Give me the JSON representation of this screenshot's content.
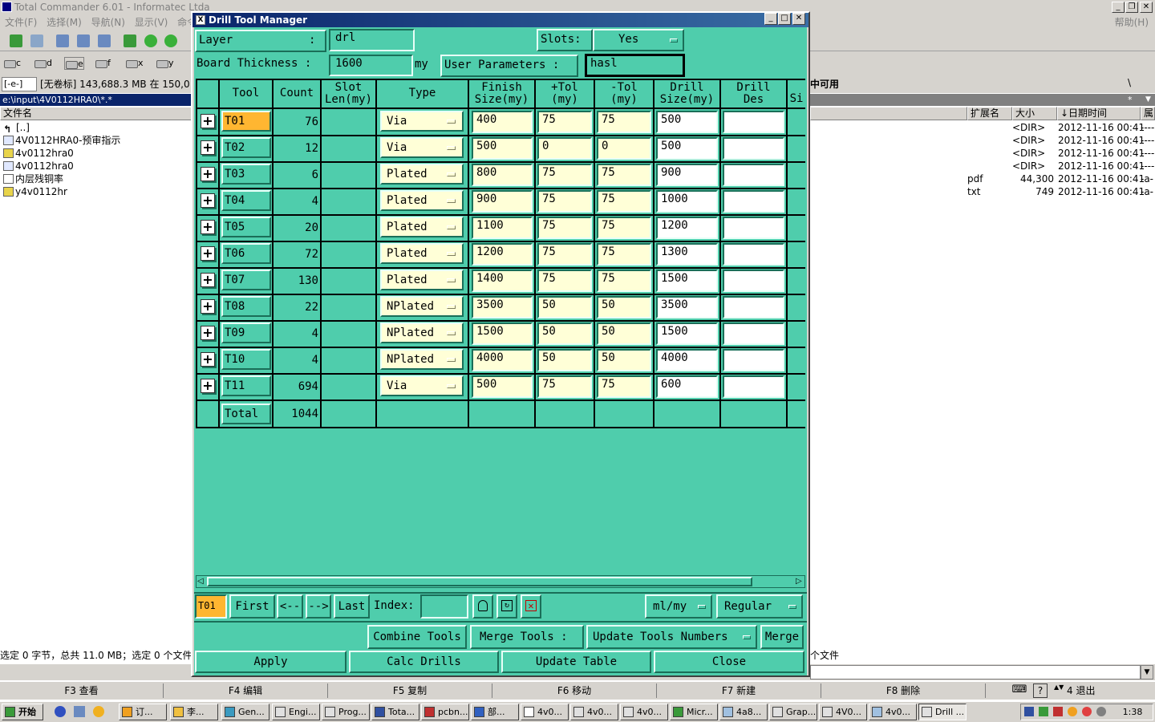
{
  "tc": {
    "title": "Total Commander 6.01 - Informatec Ltda",
    "menu": "文件(F)  选择(M)  导航(N)  显示(V)  命令(",
    "help": "帮助(H)",
    "drives": [
      "c",
      "d",
      "e",
      "f",
      "x",
      "y"
    ],
    "drive_select": "[-e-]",
    "drive_info": "[无卷标]  143,688.3 MB 在 150,0",
    "right_free": "中可用",
    "left_path": "e:\\input\\4V0112HRA0\\*.*",
    "left_header": "文件名",
    "right_headers": {
      "ext": "扩展名",
      "size": "大小",
      "date": "↓日期时间",
      "attr": "属"
    },
    "right_backslash": "\\",
    "right_star": "*",
    "left_files": [
      {
        "name": "[..]",
        "icon": "up-dir-icon"
      },
      {
        "name": "4V0112HRA0-预审指示",
        "icon": "doc-icon"
      },
      {
        "name": "4v0112hra0",
        "icon": "folder-icon"
      },
      {
        "name": "4v0112hra0",
        "icon": "doc-icon"
      },
      {
        "name": "内层残铜率",
        "icon": "text-icon"
      },
      {
        "name": "y4v0112hr",
        "icon": "folder-icon"
      }
    ],
    "right_files": [
      {
        "ext": "",
        "size": "<DIR>",
        "date": "2012-11-16 00:41",
        "attr": "----"
      },
      {
        "ext": "",
        "size": "<DIR>",
        "date": "2012-11-16 00:41",
        "attr": "----"
      },
      {
        "ext": "",
        "size": "<DIR>",
        "date": "2012-11-16 00:41",
        "attr": "----"
      },
      {
        "ext": "",
        "size": "<DIR>",
        "date": "2012-11-16 00:41",
        "attr": "----"
      },
      {
        "ext": "pdf",
        "size": "44,300",
        "date": "2012-11-16 00:41",
        "attr": "-a-"
      },
      {
        "ext": "txt",
        "size": "749",
        "date": "2012-11-16 00:41",
        "attr": "-a-"
      }
    ],
    "status_left": "选定 0 字节，总共 11.0 MB；选定 0 个文件",
    "status_right": "个文件",
    "fkeys": [
      "F3 查看",
      "F4 编辑",
      "F5 复制",
      "F6 移动",
      "F7 新建",
      "F8 删除"
    ],
    "exit": "4 退出",
    "help_q": "?"
  },
  "taskbar": {
    "start": "开始",
    "tasks": [
      "订...",
      "李...",
      "Gen...",
      "Engi...",
      "Prog...",
      "Tota...",
      "pcbn...",
      "部...",
      "4v0...",
      "4v0...",
      "4v0...",
      "Micr...",
      "4a8...",
      "Grap...",
      "4V0...",
      "4v0...",
      "Drill ..."
    ],
    "clock": "1:38"
  },
  "dialog": {
    "title": "Drill Tool Manager",
    "layer_label": "Layer",
    "colon": ":",
    "layer_value": "drl",
    "slots_label": "Slots:",
    "slots_value": "Yes",
    "board_label": "Board Thickness  :",
    "board_value": "1600",
    "board_unit": "my",
    "user_label": "User Parameters  :",
    "user_value": "hasl",
    "headers": {
      "tool": "Tool",
      "count": "Count",
      "slot1": "Slot",
      "slot2": "Len(my)",
      "type": "Type",
      "finish1": "Finish",
      "finish2": "Size(my)",
      "ptol1": "+Tol",
      "ptol2": "(my)",
      "mtol1": "-Tol",
      "mtol2": "(my)",
      "drill1": "Drill",
      "drill2": "Size(my)",
      "des1": "Drill",
      "des2": "Des",
      "si": "Si"
    },
    "rows": [
      {
        "tool": "T01",
        "count": "76",
        "type": "Via",
        "finish": "400",
        "ptol": "75",
        "mtol": "75",
        "drill": "500",
        "des": ""
      },
      {
        "tool": "T02",
        "count": "12",
        "type": "Via",
        "finish": "500",
        "ptol": "0",
        "mtol": "0",
        "drill": "500",
        "des": ""
      },
      {
        "tool": "T03",
        "count": "6",
        "type": "Plated",
        "finish": "800",
        "ptol": "75",
        "mtol": "75",
        "drill": "900",
        "des": ""
      },
      {
        "tool": "T04",
        "count": "4",
        "type": "Plated",
        "finish": "900",
        "ptol": "75",
        "mtol": "75",
        "drill": "1000",
        "des": ""
      },
      {
        "tool": "T05",
        "count": "20",
        "type": "Plated",
        "finish": "1100",
        "ptol": "75",
        "mtol": "75",
        "drill": "1200",
        "des": ""
      },
      {
        "tool": "T06",
        "count": "72",
        "type": "Plated",
        "finish": "1200",
        "ptol": "75",
        "mtol": "75",
        "drill": "1300",
        "des": ""
      },
      {
        "tool": "T07",
        "count": "130",
        "type": "Plated",
        "finish": "1400",
        "ptol": "75",
        "mtol": "75",
        "drill": "1500",
        "des": ""
      },
      {
        "tool": "T08",
        "count": "22",
        "type": "NPlated",
        "finish": "3500",
        "ptol": "50",
        "mtol": "50",
        "drill": "3500",
        "des": ""
      },
      {
        "tool": "T09",
        "count": "4",
        "type": "NPlated",
        "finish": "1500",
        "ptol": "50",
        "mtol": "50",
        "drill": "1500",
        "des": ""
      },
      {
        "tool": "T10",
        "count": "4",
        "type": "NPlated",
        "finish": "4000",
        "ptol": "50",
        "mtol": "50",
        "drill": "4000",
        "des": ""
      },
      {
        "tool": "T11",
        "count": "694",
        "type": "Via",
        "finish": "500",
        "ptol": "75",
        "mtol": "75",
        "drill": "600",
        "des": ""
      }
    ],
    "total_label": "Total",
    "total_count": "1044",
    "nav": {
      "current": "T01",
      "first": "First",
      "prev": "<--",
      "next": "-->",
      "last": "Last",
      "index_label": "Index:",
      "index_value": "",
      "units": "ml/my",
      "mode": "Regular"
    },
    "bottom": {
      "combine": "Combine Tools",
      "merge_label": "Merge Tools  :",
      "merge_mode": "Update Tools Numbers",
      "merge": "Merge",
      "apply": "Apply",
      "calc": "Calc Drills",
      "update": "Update Table",
      "close": "Close"
    },
    "colors": {
      "body": "#4fcdac",
      "selected_tool": "#ffb631",
      "input_yellow": "#ffffd7"
    }
  }
}
